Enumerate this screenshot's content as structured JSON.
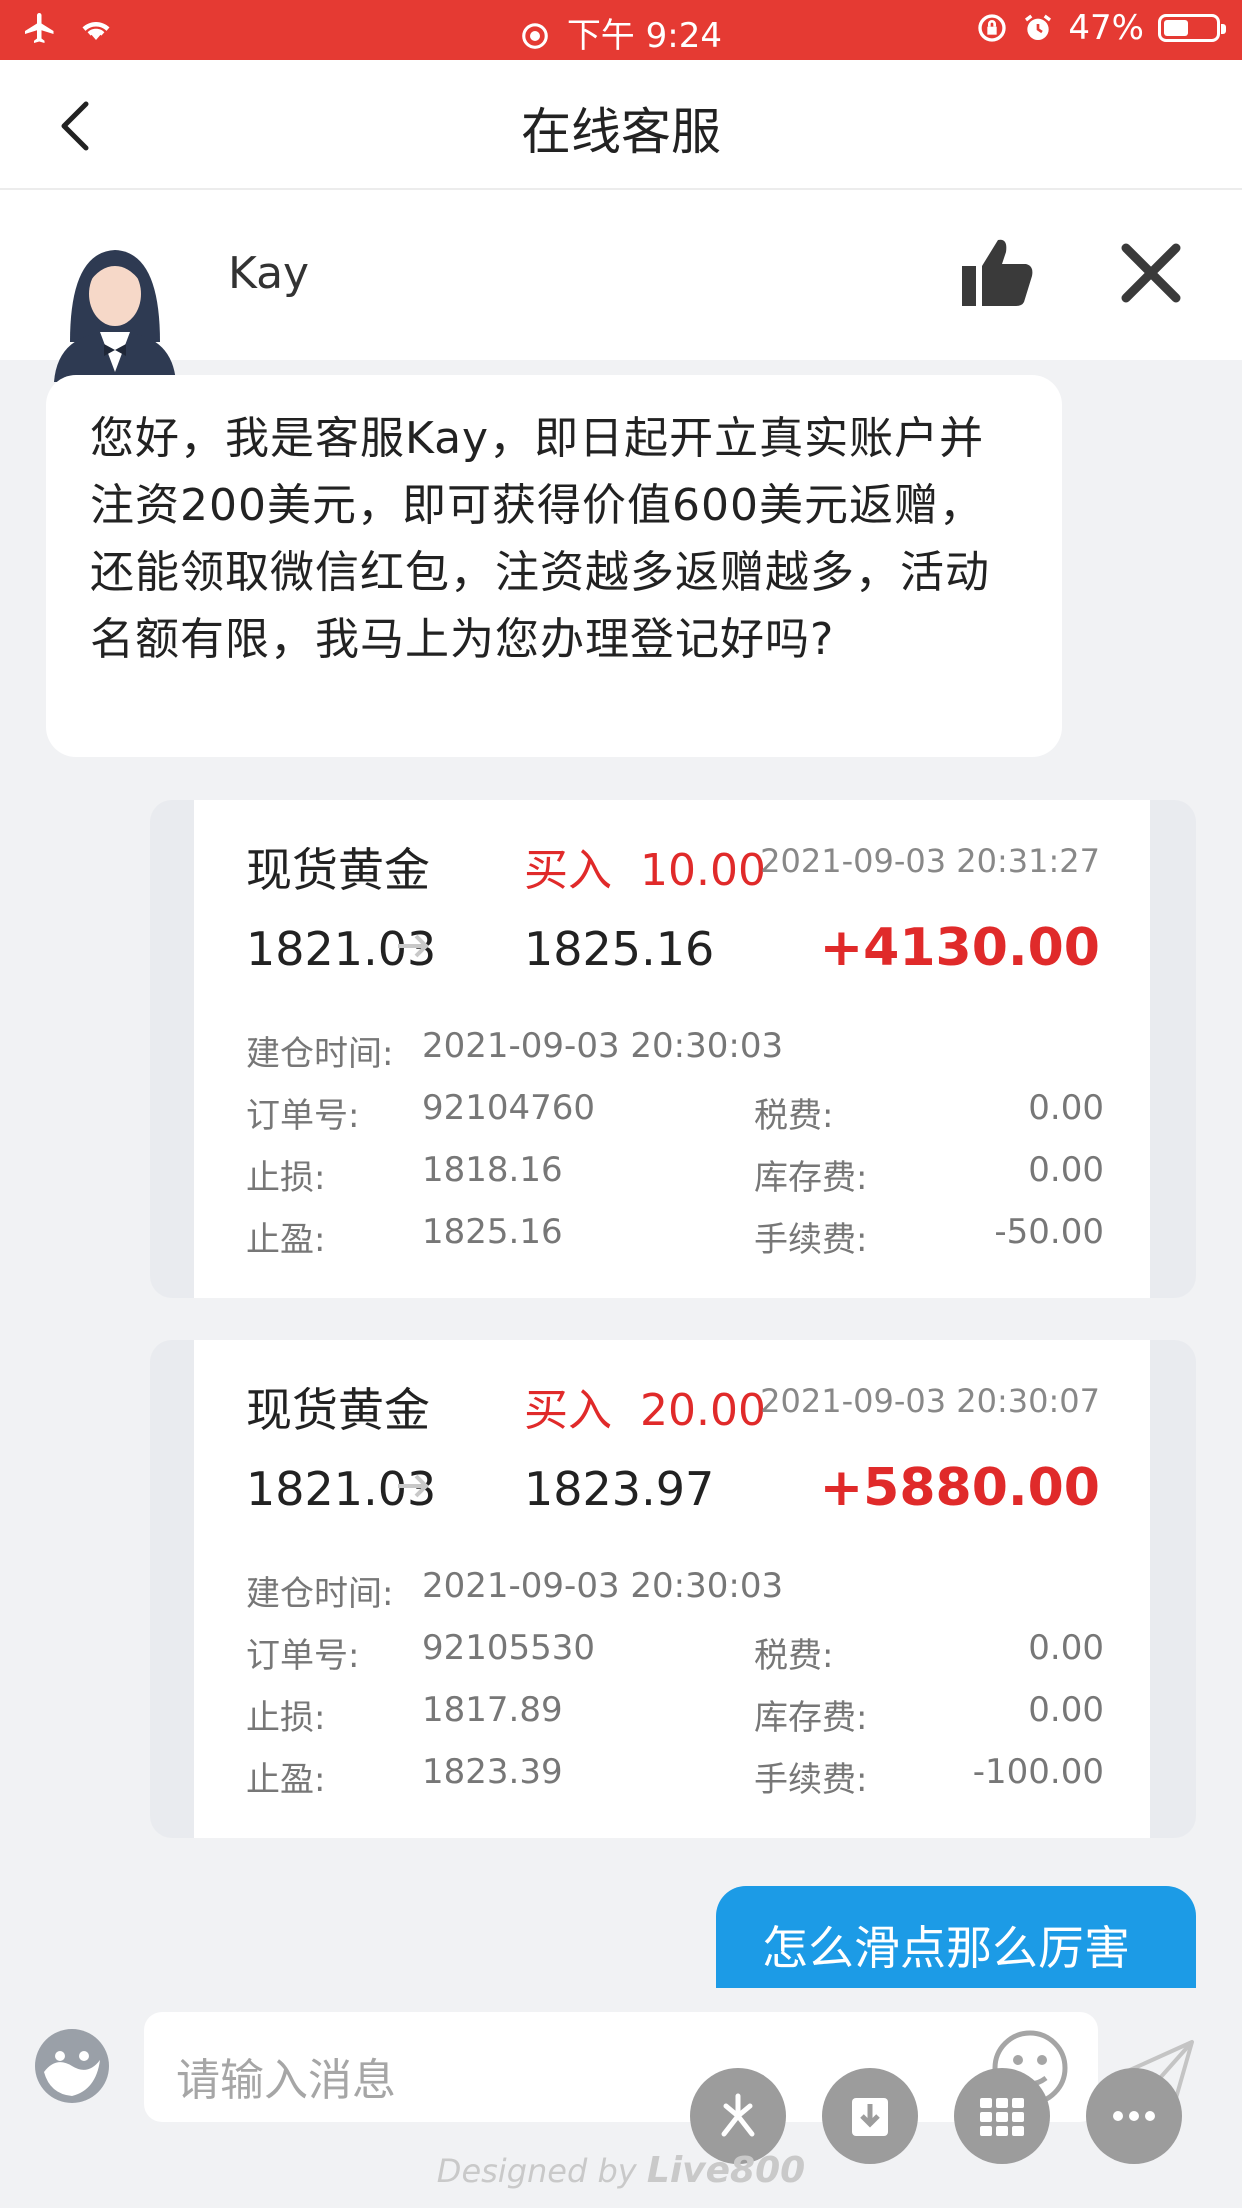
{
  "status_bar": {
    "time": "下午 9:24",
    "battery": "47%",
    "battery_level": 0.47
  },
  "nav": {
    "title": "在线客服"
  },
  "agent": {
    "name": "Kay"
  },
  "greeting": "您好，我是客服Kay，即日起开立真实账户并注资200美元，即可获得价值600美元返赠，还能领取微信红包，注资越多返赠越多，活动名额有限，我马上为您办理登记好吗?",
  "trades": [
    {
      "name": "现货黄金",
      "action": "买入",
      "lots": "10.00",
      "time": "2021-09-03 20:31:27",
      "open_price": "1821.03",
      "close_price": "1825.16",
      "profit": "+4130.00",
      "labels": {
        "open_time": "建仓时间:",
        "order": "订单号:",
        "stop_loss": "止损:",
        "take_profit": "止盈:",
        "tax": "税费:",
        "storage": "库存费:",
        "fee": "手续费:"
      },
      "open_time": "2021-09-03 20:30:03",
      "order_no": "92104760",
      "stop_loss": "1818.16",
      "take_profit": "1825.16",
      "tax": "0.00",
      "storage": "0.00",
      "fee": "-50.00"
    },
    {
      "name": "现货黄金",
      "action": "买入",
      "lots": "20.00",
      "time": "2021-09-03 20:30:07",
      "open_price": "1821.03",
      "close_price": "1823.97",
      "profit": "+5880.00",
      "labels": {
        "open_time": "建仓时间:",
        "order": "订单号:",
        "stop_loss": "止损:",
        "take_profit": "止盈:",
        "tax": "税费:",
        "storage": "库存费:",
        "fee": "手续费:"
      },
      "open_time": "2021-09-03 20:30:03",
      "order_no": "92105530",
      "stop_loss": "1817.89",
      "take_profit": "1823.39",
      "tax": "0.00",
      "storage": "0.00",
      "fee": "-100.00"
    }
  ],
  "outgoing_message": "怎么滑点那么厉害",
  "input": {
    "placeholder": "请输入消息"
  },
  "footer": {
    "designed_by": "Designed by",
    "brand": "Live800"
  },
  "colors": {
    "status_bar": "#e53a33",
    "profit_red": "#e02a2a",
    "bubble_blue": "#1c9be6"
  }
}
